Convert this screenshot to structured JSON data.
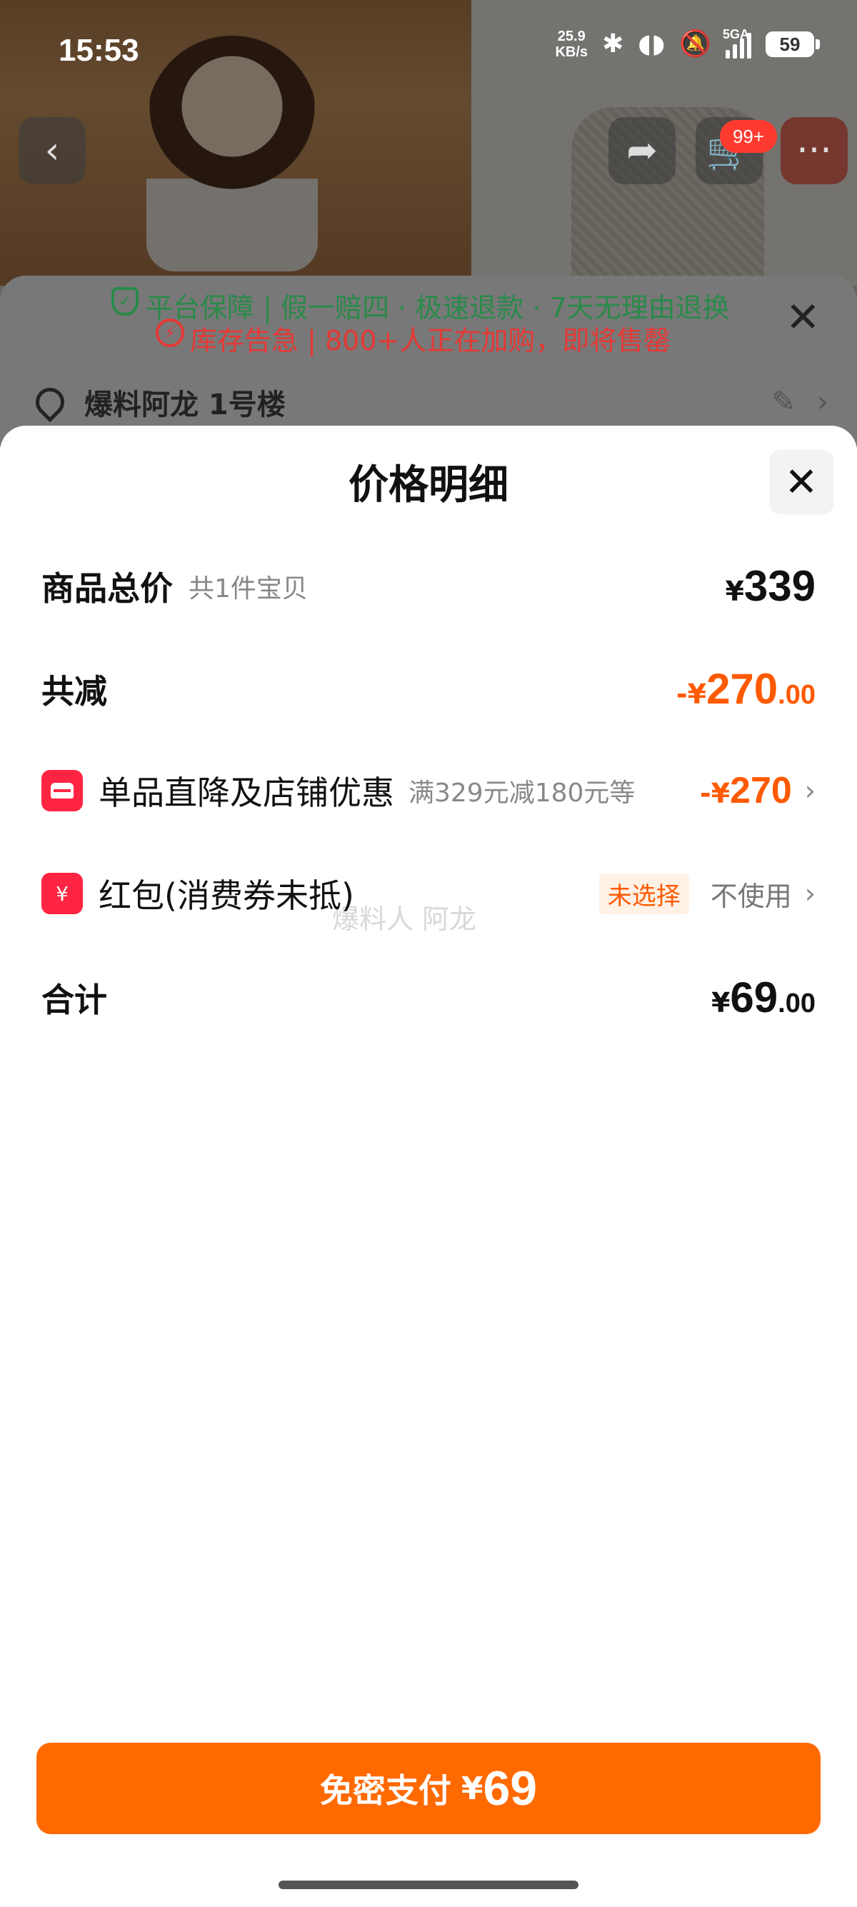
{
  "status_bar": {
    "time": "15:53",
    "net_speed_value": "25.9",
    "net_speed_unit": "KB/s",
    "network": "5GA",
    "battery": "59"
  },
  "background": {
    "cart_badge": "99+",
    "guarantee": "平台保障 | 假一赔四 · 极速退款 · 7天无理由退换",
    "stock": "库存告急 | 800+人正在加购，即将售罄",
    "address": "爆料阿龙 1号楼"
  },
  "sheet": {
    "title": "价格明细",
    "watermark": "爆料人 阿龙",
    "goods_total": {
      "label": "商品总价",
      "sub": "共1件宝贝",
      "yen": "¥",
      "amount": "339"
    },
    "discount": {
      "label": "共减",
      "prefix": "-¥",
      "amount": "270",
      "decimal": ".00"
    },
    "shop_promo": {
      "label": "单品直降及店铺优惠",
      "sub": "满329元减180元等",
      "prefix": "-¥",
      "amount": "270"
    },
    "red_packet": {
      "icon_text": "¥",
      "label": "红包(消费券未抵)",
      "tag": "未选择",
      "value": "不使用"
    },
    "total": {
      "label": "合计",
      "yen": "¥",
      "amount": "69",
      "decimal": ".00"
    }
  },
  "pay_button": {
    "label": "免密支付",
    "yen": "¥",
    "amount": "69"
  },
  "colors": {
    "accent": "#ff6a00",
    "discount": "#ff5a00",
    "icon_red": "#ff2442"
  }
}
